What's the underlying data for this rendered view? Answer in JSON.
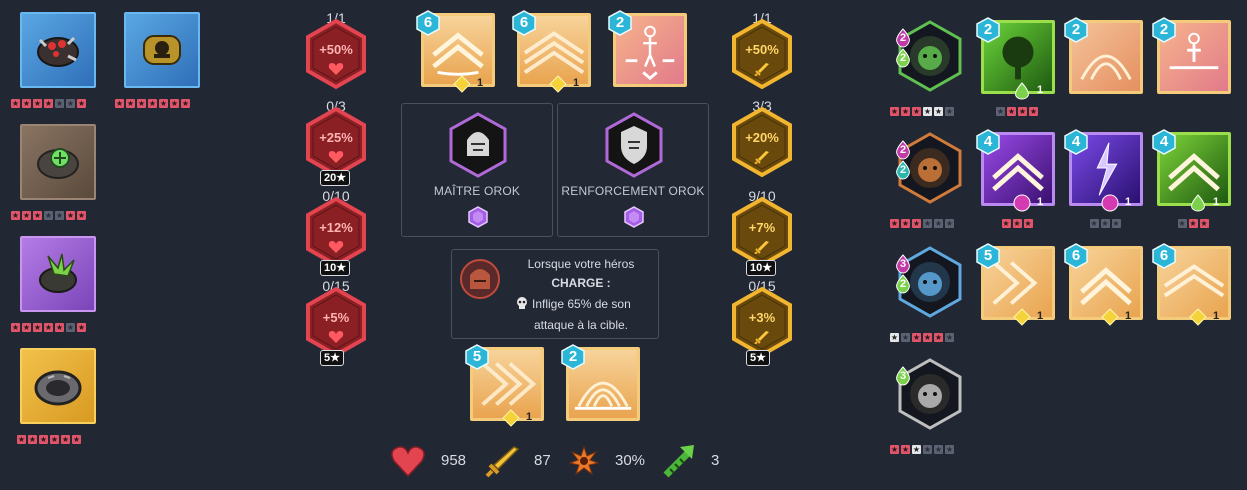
{
  "rings": {
    "r1": {
      "stars": [
        1,
        1,
        1,
        1,
        0,
        0,
        1
      ],
      "color": "#5fb0e8"
    },
    "r2": {
      "stars": [
        1,
        1,
        1,
        1,
        1,
        1,
        1
      ],
      "color": "#5fb0e8"
    },
    "r3": {
      "stars": [
        1,
        1,
        1,
        0,
        0,
        1,
        1
      ],
      "color": "#8d7766"
    },
    "r4": {
      "stars": [
        1,
        1,
        1,
        1,
        1,
        0,
        1
      ],
      "color": "#b57de6"
    },
    "r5": {
      "stars": [
        1,
        1,
        1,
        1,
        1,
        1
      ],
      "color": "#f2c14b"
    }
  },
  "hp_bonuses": [
    {
      "frac": "1/1",
      "value": "+50%"
    },
    {
      "frac": "0/3",
      "value": "+25%",
      "level": "20"
    },
    {
      "frac": "0/10",
      "value": "+12%",
      "level": "10"
    },
    {
      "frac": "0/15",
      "value": "+5%",
      "level": "5"
    }
  ],
  "atk_bonuses": [
    {
      "frac": "1/1",
      "value": "+50%"
    },
    {
      "frac": "3/3",
      "value": "+20%"
    },
    {
      "frac": "9/10",
      "value": "+7%",
      "level": "10"
    },
    {
      "frac": "0/15",
      "value": "+3%",
      "level": "5"
    }
  ],
  "top_skills": [
    {
      "num": "6",
      "gem": "1"
    },
    {
      "num": "6",
      "gem": "1"
    },
    {
      "num": "2"
    }
  ],
  "panels": {
    "left_label": "MAÎTRE OROK",
    "right_label": "RENFORCEMENT OROK"
  },
  "charge": {
    "line1": "Lorsque votre héros",
    "line2": "CHARGE :",
    "line3": "Inflige 65% de son",
    "line4": "attaque à la cible."
  },
  "bottom_skills": [
    {
      "num": "5",
      "gem": "1"
    },
    {
      "num": "2"
    }
  ],
  "stats": {
    "hp": "958",
    "atk": "87",
    "crit": "30%",
    "speed": "3"
  },
  "heroes": [
    {
      "badge_top": "2",
      "badge_bot": "2",
      "stars": [
        1,
        1,
        1,
        2,
        2,
        0
      ],
      "skills": [
        {
          "num": "2",
          "gem": "1",
          "gem_color": "green",
          "stars": [
            0,
            1,
            1,
            1
          ]
        },
        {
          "num": "2"
        },
        {
          "num": "2"
        }
      ]
    },
    {
      "badge_top": "2",
      "badge_bot": "2",
      "stars": [
        1,
        1,
        1,
        0,
        0,
        0
      ],
      "skills": [
        {
          "num": "4",
          "gem": "1",
          "gem_color": "pink",
          "stars": [
            1,
            1,
            1
          ]
        },
        {
          "num": "4",
          "gem": "1",
          "gem_color": "pink",
          "stars": [
            0,
            0,
            0
          ]
        },
        {
          "num": "4",
          "gem": "1",
          "gem_color": "green",
          "stars": [
            0,
            1,
            1
          ]
        }
      ]
    },
    {
      "badge_top": "3",
      "badge_bot": "2",
      "stars": [
        2,
        0,
        1,
        1,
        1,
        0
      ],
      "skills": [
        {
          "num": "5",
          "gem": "1"
        },
        {
          "num": "6",
          "gem": "1"
        },
        {
          "num": "6",
          "gem": "1"
        }
      ]
    },
    {
      "badge_top": "3",
      "stars": [
        1,
        1,
        2,
        0,
        0,
        0
      ],
      "skills": []
    }
  ],
  "colors": {
    "hp": "#e2454f",
    "atk": "#f2b52f",
    "tile": "#f3cb7a",
    "bg": "#222734"
  }
}
